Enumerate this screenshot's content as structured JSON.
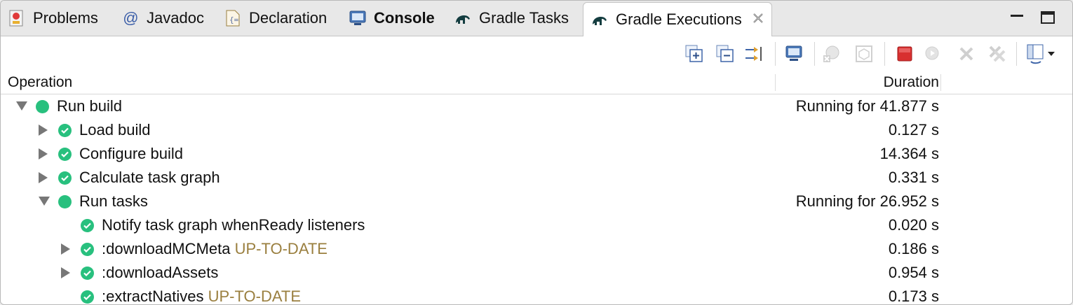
{
  "tabs": [
    {
      "label": "Problems",
      "icon": "problems-icon"
    },
    {
      "label": "Javadoc",
      "icon": "javadoc-icon",
      "glyph": "@"
    },
    {
      "label": "Declaration",
      "icon": "declaration-icon"
    },
    {
      "label": "Console",
      "icon": "console-icon"
    },
    {
      "label": "Gradle Tasks",
      "icon": "gradle-elephant-icon"
    },
    {
      "label": "Gradle Executions",
      "icon": "gradle-elephant-icon",
      "active": true
    }
  ],
  "header": {
    "operation": "Operation",
    "duration": "Duration"
  },
  "rows": [
    {
      "label": "Run build",
      "tag": "",
      "duration": "Running for 41.877 s",
      "level": 0,
      "expander": "down",
      "state": "running"
    },
    {
      "label": "Load build",
      "tag": "",
      "duration": "0.127 s",
      "level": 1,
      "expander": "right",
      "state": "done"
    },
    {
      "label": "Configure build",
      "tag": "",
      "duration": "14.364 s",
      "level": 1,
      "expander": "right",
      "state": "done"
    },
    {
      "label": "Calculate task graph",
      "tag": "",
      "duration": "0.331 s",
      "level": 1,
      "expander": "right",
      "state": "done"
    },
    {
      "label": "Run tasks",
      "tag": "",
      "duration": "Running for 26.952 s",
      "level": 1,
      "expander": "down",
      "state": "running"
    },
    {
      "label": "Notify task graph whenReady listeners",
      "tag": "",
      "duration": "0.020 s",
      "level": 2,
      "expander": "none",
      "state": "done"
    },
    {
      "label": ":downloadMCMeta",
      "tag": "UP-TO-DATE",
      "duration": "0.186 s",
      "level": 2,
      "expander": "right",
      "state": "done"
    },
    {
      "label": ":downloadAssets",
      "tag": "",
      "duration": "0.954 s",
      "level": 2,
      "expander": "right",
      "state": "done"
    },
    {
      "label": ":extractNatives",
      "tag": "UP-TO-DATE",
      "duration": "0.173 s",
      "level": 2,
      "expander": "none",
      "state": "done"
    }
  ],
  "colors": {
    "status_green": "#28c07e",
    "tag_gold": "#9a7f3f",
    "stop_red": "#d83030"
  }
}
